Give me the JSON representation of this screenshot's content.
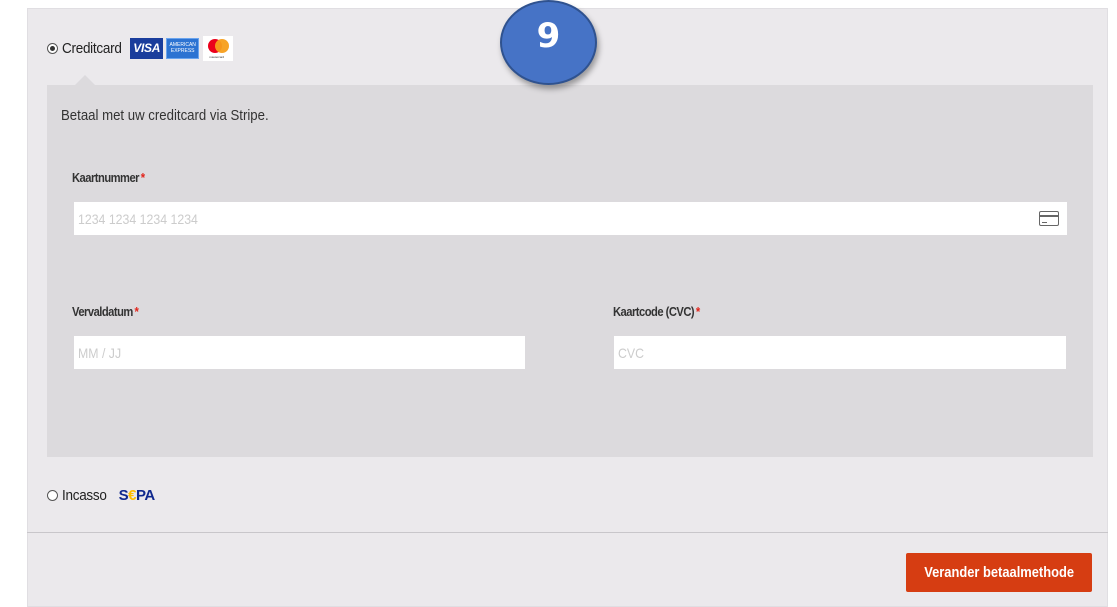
{
  "step_badge": "9",
  "payment": {
    "creditcard": {
      "label": "Creditcard",
      "selected": true,
      "logos": {
        "visa": "VISA",
        "amex_line1": "AMERICAN",
        "amex_line2": "EXPRESS",
        "mastercard": "mastercard"
      },
      "intro": "Betaal met uw creditcard via Stripe.",
      "card_number": {
        "label": "Kaartnummer",
        "required_mark": "*",
        "placeholder": "1234 1234 1234 1234",
        "icon": "credit-card-icon"
      },
      "expiry": {
        "label": "Vervaldatum",
        "required_mark": "*",
        "placeholder": "MM / JJ"
      },
      "cvc": {
        "label": "Kaartcode (CVC)",
        "required_mark": "*",
        "placeholder": "CVC"
      }
    },
    "incasso": {
      "label": "Incasso",
      "selected": false,
      "logo_s": "S",
      "logo_e": "€",
      "logo_pa": "PA"
    }
  },
  "submit_button": "Verander betaalmethode",
  "colors": {
    "accent": "#d63d12",
    "badge": "#4673c6",
    "required": "#e2231a"
  }
}
